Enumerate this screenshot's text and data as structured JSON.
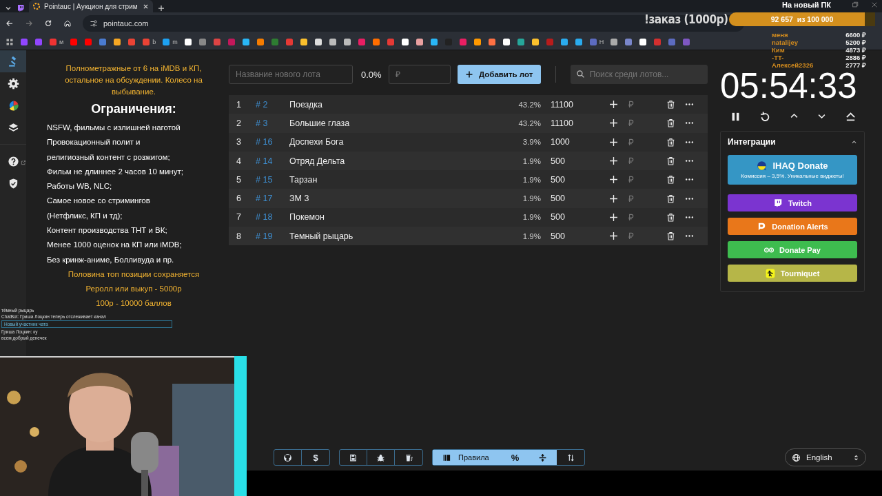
{
  "browser": {
    "tab_title": "Pointauc | Аукцион для стрим",
    "url": "pointauc.com",
    "bookmark_labels": [
      "м",
      "b",
      "m",
      "Н"
    ]
  },
  "nav": [
    {
      "kind": "auction",
      "selected": true
    },
    {
      "kind": "settings",
      "selected": false
    },
    {
      "kind": "stats",
      "selected": false
    },
    {
      "kind": "layers",
      "selected": false
    },
    {
      "kind": "help",
      "selected": false
    },
    {
      "kind": "shield",
      "selected": false
    }
  ],
  "rules": {
    "intro": "Полнометражные от 6 на iMDB и КП, остальное на обсуждении. Колесо на выбывание.",
    "heading": "Ограничения:",
    "items": [
      "NSFW, фильмы с излишней наготой",
      "Провокационный полит и",
      "религиозный контент с розжигом;",
      "Фильм не длиннее 2 часов 10 минут;",
      "Работы WB, NLC;",
      "Самое новое со стримингов",
      "(Нетфликс, КП и тд);",
      "Контент производства ТНТ и ВК;",
      "Менее 1000 оценок на КП или iMDB;",
      "Без кринж-аниме, Болливуда и пр."
    ],
    "footer": [
      "Половина топ позиции сохраняется",
      "Реролл или выкуп - 5000р",
      "100р - 10000 баллов"
    ]
  },
  "new_lot": {
    "name_placeholder": "Название нового лота",
    "percent": "0.0%",
    "amount_placeholder": "₽",
    "add_button": "Добавить лот",
    "search_placeholder": "Поиск среди лотов..."
  },
  "lots": [
    {
      "place": "1",
      "id": "# 2",
      "name": "Поездка",
      "percent": "43.2%",
      "amount": "11100"
    },
    {
      "place": "2",
      "id": "# 3",
      "name": "Большие глаза",
      "percent": "43.2%",
      "amount": "11100"
    },
    {
      "place": "3",
      "id": "# 16",
      "name": "Доспехи Бога",
      "percent": "3.9%",
      "amount": "1000"
    },
    {
      "place": "4",
      "id": "# 14",
      "name": "Отряд Дельта",
      "percent": "1.9%",
      "amount": "500"
    },
    {
      "place": "5",
      "id": "# 15",
      "name": "Тарзан",
      "percent": "1.9%",
      "amount": "500"
    },
    {
      "place": "6",
      "id": "# 17",
      "name": "ЗМ 3",
      "percent": "1.9%",
      "amount": "500"
    },
    {
      "place": "7",
      "id": "# 18",
      "name": "Покемон",
      "percent": "1.9%",
      "amount": "500"
    },
    {
      "place": "8",
      "id": "# 19",
      "name": "Темный рыцарь",
      "percent": "1.9%",
      "amount": "500"
    }
  ],
  "timer": "05:54:33",
  "integrations": {
    "title": "Интеграции",
    "expanded": true,
    "services": [
      {
        "kind": "ihaq",
        "label": "IHAQ Donate",
        "subtitle": "Комиссия – 3,5%. Уникальные виджеты!",
        "color": "#3596c5"
      },
      {
        "kind": "twitch",
        "label": "Twitch",
        "color": "#7b34d0"
      },
      {
        "kind": "donationalerts",
        "label": "Donation Alerts",
        "color": "#e9771a"
      },
      {
        "kind": "donatepay",
        "label": "Donate Pay",
        "color": "#3ebc4f"
      },
      {
        "kind": "tourniquet",
        "label": "Tourniquet",
        "color": "#b6b648"
      }
    ]
  },
  "toolbar": {
    "links": [
      {
        "kind": "github"
      },
      {
        "kind": "dollar",
        "label": "$"
      }
    ],
    "actions": [
      {
        "kind": "save"
      },
      {
        "kind": "bug"
      },
      {
        "kind": "clear"
      }
    ],
    "modes": [
      {
        "kind": "rules",
        "label": "Правила",
        "selected": true
      },
      {
        "kind": "percent",
        "label": "%",
        "selected": true
      },
      {
        "kind": "split",
        "selected": true
      },
      {
        "kind": "sort",
        "selected": false
      }
    ]
  },
  "language": "English",
  "stream_overlay": {
    "goal_title": "На новый ПК",
    "goal_text": "92 657  из 100 000",
    "level": 0.93,
    "order": "!заказ (1000р)",
    "donors": [
      {
        "name": "меня",
        "amount": "6600 ₽"
      },
      {
        "name": "natalijey",
        "amount": "5200 ₽"
      },
      {
        "name": "Ким",
        "amount": "4873 ₽"
      },
      {
        "name": "-TT-",
        "amount": "2886 ₽"
      },
      {
        "name": "Алексей2326",
        "amount": "2777 ₽"
      }
    ]
  },
  "chat": [
    {
      "kind": "line",
      "text": "тёмный рыцарь"
    },
    {
      "kind": "line",
      "text": "ChatBot: Гриша Лоцкин теперь отслеживает канал"
    },
    {
      "kind": "notice",
      "text": "Новый участник чата"
    },
    {
      "kind": "line",
      "text": "Гриша Лоцкин: ку"
    },
    {
      "kind": "line",
      "text": "всем добрый денечек"
    }
  ]
}
